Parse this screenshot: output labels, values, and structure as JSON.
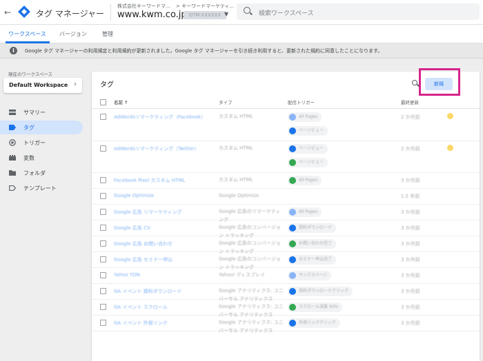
{
  "header": {
    "app_title": "タグ マネージャー",
    "account": "株式会社キーワードマ...",
    "container_path": "> キーワードマーケティ...",
    "domain": "www.kwm.co.jp",
    "container_id": "GTM-XXXXXX",
    "search_placeholder": "検索ワークスペース"
  },
  "tabs": [
    "ワークスペース",
    "バージョン",
    "管理"
  ],
  "notice": "Google タグ マネージャーの利用規定と利用規約が更新されました。Google タグ マネージャーを引き続き利用すると、更新された規約に同意したことになります。",
  "sidebar": {
    "workspace_label": "現在のワークスペース",
    "workspace_name": "Default Workspace",
    "items": [
      {
        "label": "サマリー",
        "icon": "summary-icon"
      },
      {
        "label": "タグ",
        "icon": "tag-icon",
        "active": true
      },
      {
        "label": "トリガー",
        "icon": "trigger-icon"
      },
      {
        "label": "変数",
        "icon": "variables-icon"
      },
      {
        "label": "フォルダ",
        "icon": "folder-icon"
      },
      {
        "label": "テンプレート",
        "icon": "template-icon"
      }
    ]
  },
  "main": {
    "title": "タグ",
    "new_button": "新規",
    "columns": {
      "name": "名前 ↑",
      "type": "タイプ",
      "trigger": "配信トリガー",
      "updated": "最終更新"
    }
  },
  "rows": [
    {
      "name": "AdWordsリマーケティング（Facebook）",
      "type": "カスタム HTML",
      "triggers": [
        "All Pages",
        "ページビュー"
      ],
      "updated": "2 か月前",
      "warn": true
    },
    {
      "name": "AdWordsリマーケティング（Twitter）",
      "type": "カスタム HTML",
      "triggers": [
        "ページビュー",
        "ページビュー"
      ],
      "updated": "2 か月前",
      "warn": true
    },
    {
      "name": "Facebook Pixel カスタム HTML",
      "type": "カスタム HTML",
      "triggers": [
        "All Pages"
      ],
      "updated": "3 か月前"
    },
    {
      "name": "Google Optimize",
      "type": "Google Optimize",
      "triggers": [],
      "updated": "1.5 年前"
    },
    {
      "name": "Google 広告 リマーケティング",
      "type": "Google 広告のリマーケティング",
      "triggers": [
        "All Pages"
      ],
      "updated": "3 か月前"
    },
    {
      "name": "Google 広告 CV",
      "type": "Google 広告のコンバージョン トラッキング",
      "triggers": [
        "資料ダウンロード"
      ],
      "updated": "3 か月前"
    },
    {
      "name": "Google 広告 お問い合わせ",
      "type": "Google 広告のコンバージョン トラッキング",
      "triggers": [
        "お問い合わせ完了"
      ],
      "updated": "3 か月前"
    },
    {
      "name": "Google 広告 セミナー申込",
      "type": "Google 広告のコンバージョン トラッキング",
      "triggers": [
        "セミナー申込完了"
      ],
      "updated": "3 か月前"
    },
    {
      "name": "Yahoo YDN",
      "type": "Yahoo! ディスプレイ",
      "triggers": [
        "サンクスページ"
      ],
      "updated": "3 か月前"
    },
    {
      "name": "GA イベント 資料ダウンロード",
      "type": "Google アナリティクス: ユニバーサル アナリティクス",
      "triggers": [
        "資料ダウンロードクリック"
      ],
      "updated": "3 か月前"
    },
    {
      "name": "GA イベント スクロール",
      "type": "Google アナリティクス: ユニバーサル アナリティクス",
      "triggers": [
        "スクロール深度 90%"
      ],
      "updated": "3 か月前"
    },
    {
      "name": "GA イベント 外部リンク",
      "type": "Google アナリティクス: ユニバーサル アナリティクス",
      "triggers": [
        "外部リンククリック"
      ],
      "updated": "3 か月前"
    }
  ],
  "colors": {
    "accent": "#1a73e8",
    "highlight": "#d6248a",
    "warning": "#fbbc04"
  }
}
